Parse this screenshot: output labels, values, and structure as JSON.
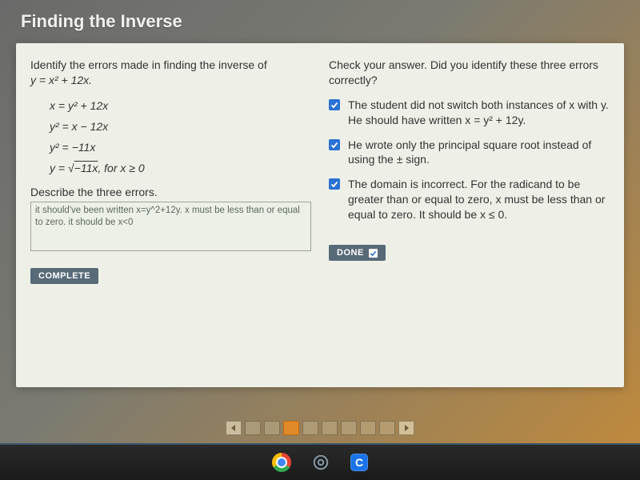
{
  "title": "Finding the Inverse",
  "left": {
    "prompt_line1": "Identify the errors made in finding the inverse of",
    "prompt_eqn": "y = x² + 12x.",
    "work": {
      "l1": "x = y² + 12x",
      "l2": "y² = x − 12x",
      "l3": "y² = −11x",
      "l4_pre": "y = √",
      "l4_rad": "−11x",
      "l4_post": ", for x ≥ 0"
    },
    "describe_label": "Describe the three errors.",
    "answer_value": "it should've been written x=y^2+12y. x must be less than or equal to zero. it should be x<0",
    "complete_label": "COMPLETE"
  },
  "right": {
    "feedback_title": "Check your answer. Did you identify these three errors correctly?",
    "errors": [
      "The student did not switch both instances of x with y. He should have written x = y² + 12y.",
      "He wrote only the principal square root instead of using the ± sign.",
      "The domain is incorrect. For the radicand to be greater than or equal to zero, x must be less than or equal to zero. It should be x ≤ 0."
    ],
    "done_label": "DONE"
  },
  "pager": {
    "total": 8,
    "active_index": 2
  },
  "taskbar": {
    "icons": [
      "chrome",
      "settings",
      "c-app"
    ]
  }
}
